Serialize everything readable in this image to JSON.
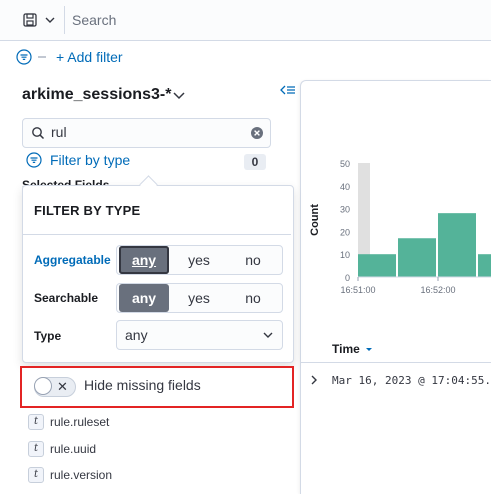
{
  "search": {
    "placeholder": "Search"
  },
  "filters": {
    "add_filter_label": "+ Add filter"
  },
  "sidebar": {
    "index_pattern": "arkime_sessions3-*",
    "field_search_value": "rul",
    "filter_by_type_label": "Filter by type",
    "filter_count": "0",
    "selected_fields_peek": "Selected Fields"
  },
  "popover": {
    "title": "FILTER BY TYPE",
    "aggregatable": {
      "label": "Aggregatable",
      "options": [
        "any",
        "yes",
        "no"
      ],
      "selected": "any"
    },
    "searchable": {
      "label": "Searchable",
      "options": [
        "any",
        "yes",
        "no"
      ],
      "selected": "any"
    },
    "type": {
      "label": "Type",
      "value": "any"
    }
  },
  "hide_missing": {
    "label": "Hide missing fields",
    "checked": false
  },
  "fields": [
    {
      "type": "t",
      "name": "rule.ruleset"
    },
    {
      "type": "t",
      "name": "rule.uuid"
    },
    {
      "type": "t",
      "name": "rule.version"
    }
  ],
  "chart_data": {
    "type": "bar",
    "ylabel": "Count",
    "xlabel": "",
    "ylim": [
      0,
      50
    ],
    "y_ticks": [
      "0",
      "10",
      "20",
      "30",
      "40",
      "50"
    ],
    "x_tick_labels": [
      "16:51:00",
      "16:52:00"
    ],
    "values": [
      10,
      17,
      28,
      10
    ],
    "highlight_bar": 50,
    "color": "#54b399",
    "highlight_color": "#e0e0e0"
  },
  "table": {
    "time_header": "Time",
    "first_row_time": "Mar 16, 2023 @ 17:04:55."
  },
  "colors": {
    "link": "#006bb8",
    "highlight_box": "#e32424",
    "bar": "#54b399"
  }
}
